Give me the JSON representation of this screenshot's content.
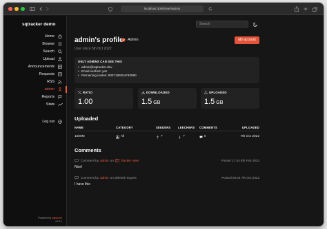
{
  "browser": {
    "url": "localhost:3000/user/admin"
  },
  "sidebar": {
    "brand": "sqtracker demo",
    "items": [
      {
        "label": "Home",
        "icon": "home-icon"
      },
      {
        "label": "Browse",
        "icon": "list-icon"
      },
      {
        "label": "Search",
        "icon": "search-icon"
      },
      {
        "label": "Upload",
        "icon": "upload-icon"
      },
      {
        "label": "Announcements",
        "icon": "announcement-icon"
      },
      {
        "label": "Requests",
        "icon": "question-icon"
      },
      {
        "label": "RSS",
        "icon": "rss-icon"
      },
      {
        "label": "admin",
        "icon": "user-icon",
        "active": true
      },
      {
        "label": "Reports",
        "icon": "flag-icon"
      },
      {
        "label": "Stats",
        "icon": "stats-icon"
      }
    ],
    "logout": "Log out",
    "powered_prefix": "Powered by",
    "powered_name": "sqtracker",
    "version": "v0.0.1"
  },
  "topbar": {
    "search_placeholder": "Search"
  },
  "profile": {
    "title": "admin's profile",
    "role": "Admin",
    "since": "User since 5th Oct 2022",
    "my_account": "My account"
  },
  "admin_box": {
    "heading": "ONLY ADMINS CAN SEE THIS",
    "items": [
      "admin@sqtracker.dev",
      "Email verified: yes",
      "Remaining invites: 9007199254740990"
    ]
  },
  "stats": [
    {
      "label": "RATIO",
      "value": "1.00",
      "unit": "",
      "icon": "percent-icon"
    },
    {
      "label": "DOWNLOADED",
      "value": "1.5",
      "unit": "GB",
      "icon": "download-icon"
    },
    {
      "label": "UPLOADED",
      "value": "1.5",
      "unit": "GB",
      "icon": "upload-icon"
    }
  ],
  "uploaded": {
    "title": "Uploaded",
    "headers": {
      "name": "NAME",
      "category": "CATEGORY",
      "seeders": "SEEDERS",
      "leechers": "LEECHERS",
      "comments": "COMMENTS",
      "uploaded": "UPLOADED"
    },
    "rows": [
      {
        "name": "1500M",
        "category": "All",
        "seeders": "?",
        "leechers": "?",
        "comments": "0",
        "uploaded": "7th Oct 2022"
      }
    ]
  },
  "comments": {
    "title": "Comments",
    "items": [
      {
        "prefix": "Comment by",
        "author": "admin",
        "on": "on",
        "target": "Tracker rules",
        "posted": "Posted 17:44 8th Feb 2023",
        "body": "Nice!"
      },
      {
        "prefix": "Comment by",
        "author": "admin",
        "on": "on deleted request",
        "target": "",
        "posted": "Posted 09:34 7th Oct 2022",
        "body": "I have this"
      }
    ]
  },
  "colors": {
    "accent": "#ef5a3c",
    "background": "#161616",
    "card": "#222222"
  }
}
